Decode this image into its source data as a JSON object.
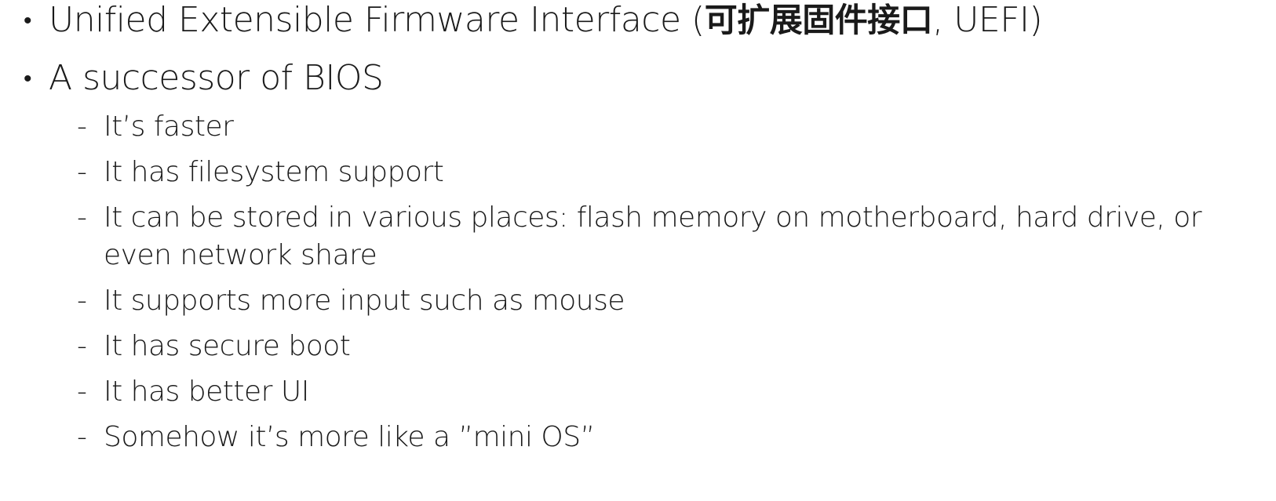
{
  "bullets": [
    {
      "pre": "Unified Extensible Firmware Interface (",
      "zh": "可扩展固件接口",
      "post": ", UEFI)"
    },
    {
      "text": "A successor of BIOS"
    }
  ],
  "subbullets": [
    "It’s faster",
    "It has filesystem support",
    "It can be stored in various places: flash memory on motherboard, hard drive, or even network share",
    "It supports more input such as mouse",
    "It has secure boot",
    "It has better UI",
    "Somehow it’s more like a ”mini OS”"
  ],
  "markers": {
    "bullet": "•",
    "dash": "-"
  }
}
